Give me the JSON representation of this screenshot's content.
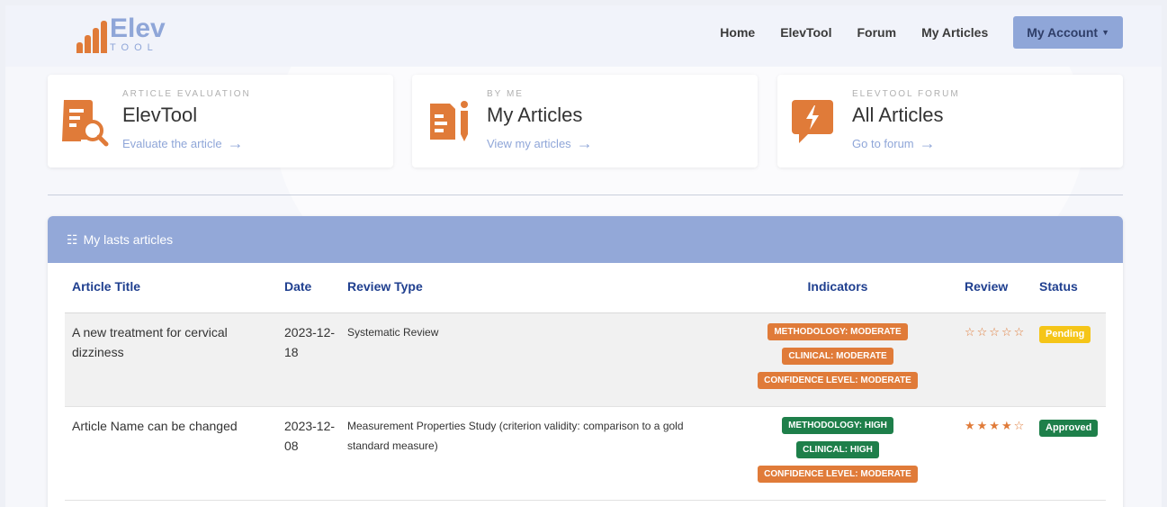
{
  "brand": {
    "name": "Elev",
    "sub": "TOOL",
    "accent": "#e07b39",
    "primary": "#8fa6d8"
  },
  "nav": {
    "links": [
      "Home",
      "ElevTool",
      "Forum",
      "My Articles"
    ],
    "account": "My Account"
  },
  "cards": [
    {
      "kicker": "ARTICLE EVALUATION",
      "title": "ElevTool",
      "link": "Evaluate the article",
      "icon": "document-search-icon"
    },
    {
      "kicker": "BY ME",
      "title": "My Articles",
      "link": "View my articles",
      "icon": "document-pen-icon"
    },
    {
      "kicker": "ELEVTOOL FORUM",
      "title": "All Articles",
      "link": "Go to forum",
      "icon": "speech-bolt-icon"
    }
  ],
  "panel": {
    "title": "My lasts articles",
    "columns": [
      "Article Title",
      "Date",
      "Review Type",
      "Indicators",
      "Review",
      "Status"
    ],
    "rows": [
      {
        "title": "A new treatment for cervical dizziness",
        "date_a": "2023-12-",
        "date_b": "18",
        "review_type": "Systematic Review",
        "indicators": [
          "METHODOLOGY: MODERATE",
          "CLINICAL: MODERATE",
          "CONFIDENCE LEVEL: MODERATE"
        ],
        "indicator_levels": [
          "moderate",
          "moderate",
          "moderate"
        ],
        "rating": 0,
        "rating_max": 5,
        "status": "Pending"
      },
      {
        "title": "Article Name can be changed",
        "date_a": "2023-12-",
        "date_b": "08",
        "review_type": "Measurement Properties Study (criterion validity: comparison to a gold standard measure)",
        "indicators": [
          "METHODOLOGY: HIGH",
          "CLINICAL: HIGH",
          "CONFIDENCE LEVEL: MODERATE"
        ],
        "indicator_levels": [
          "high",
          "high",
          "moderate"
        ],
        "rating": 4,
        "rating_max": 5,
        "status": "Approved"
      }
    ]
  }
}
